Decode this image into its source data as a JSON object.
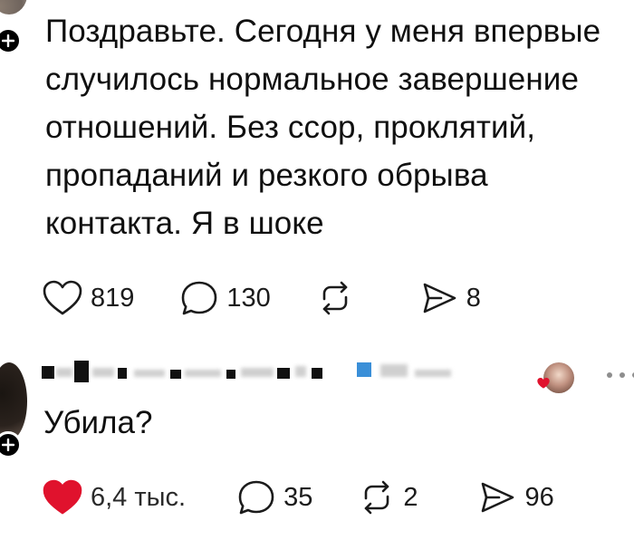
{
  "post": {
    "text": "Поздравьте. Сегодня у меня впервые случилось нормальное завершение отношений. Без ссор, проклятий, пропаданий и резкого обрыва контакта. Я в шоке",
    "likes": "819",
    "replies": "130",
    "shares": "8"
  },
  "reply": {
    "text": "Убила?",
    "likes": "6,4 тыс.",
    "replies": "35",
    "reposts": "2",
    "shares": "96"
  },
  "colors": {
    "text": "#101010",
    "liked_heart": "#e0122d",
    "icon_gray": "#1b1b1b",
    "more_dots": "#8e8e8e",
    "background": "#ffffff"
  },
  "icons": {
    "like": "heart-outline-icon",
    "liked": "heart-filled-icon",
    "reply": "speech-bubble-icon",
    "repost": "repost-arrows-icon",
    "share": "paper-plane-icon",
    "more": "more-dots-icon",
    "follow": "plus-icon"
  }
}
